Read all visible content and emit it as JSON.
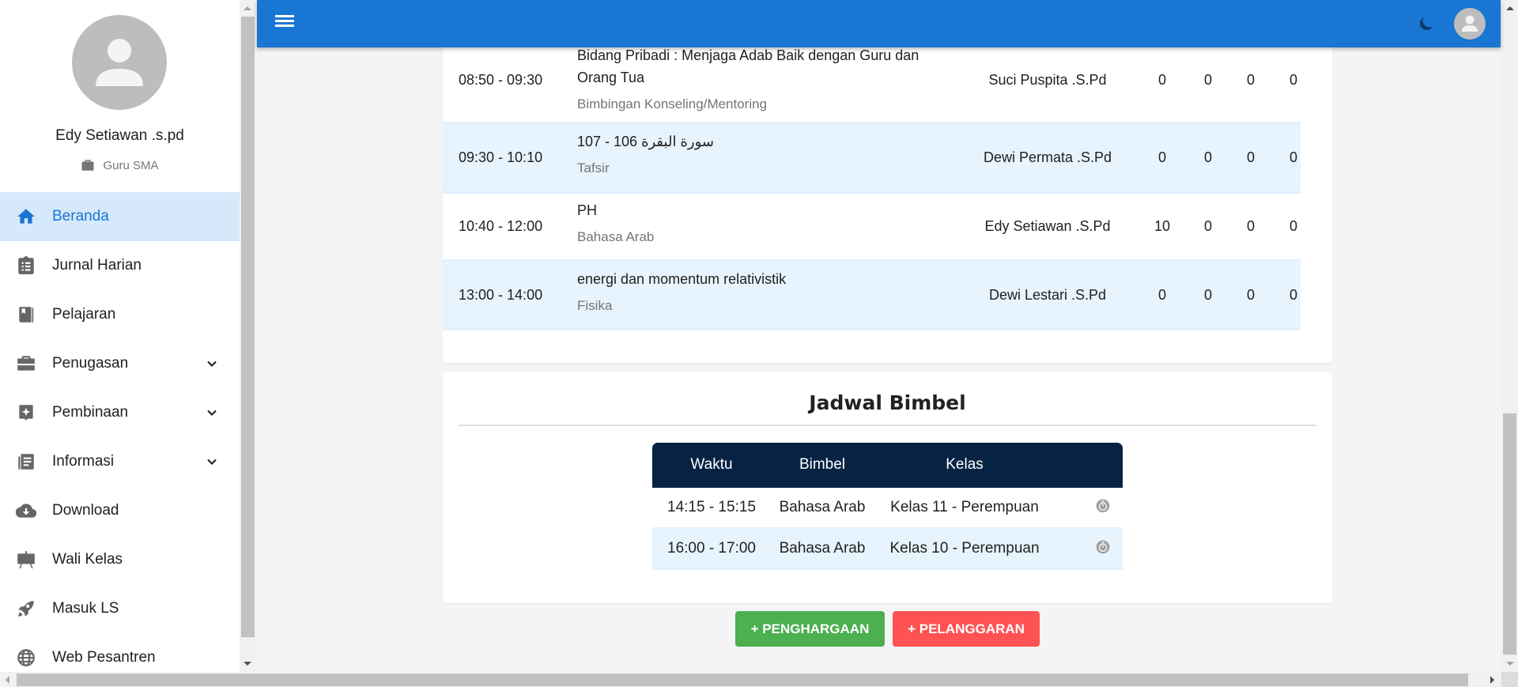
{
  "profile": {
    "name": "Edy Setiawan .s.pd",
    "role": "Guru SMA",
    "role_icon": "briefcase-icon"
  },
  "sidebar": {
    "items": [
      {
        "label": "Beranda",
        "icon": "home-icon",
        "active": true,
        "expandable": false
      },
      {
        "label": "Jurnal Harian",
        "icon": "clipboard-list-icon",
        "active": false,
        "expandable": false
      },
      {
        "label": "Pelajaran",
        "icon": "book-icon",
        "active": false,
        "expandable": false
      },
      {
        "label": "Penugasan",
        "icon": "briefcase-icon",
        "active": false,
        "expandable": true
      },
      {
        "label": "Pembinaan",
        "icon": "sparkle-badge-icon",
        "active": false,
        "expandable": true
      },
      {
        "label": "Informasi",
        "icon": "newspaper-icon",
        "active": false,
        "expandable": true
      },
      {
        "label": "Download",
        "icon": "cloud-download-icon",
        "active": false,
        "expandable": false
      },
      {
        "label": "Wali Kelas",
        "icon": "easel-icon",
        "active": false,
        "expandable": false
      },
      {
        "label": "Masuk LS",
        "icon": "rocket-icon",
        "active": false,
        "expandable": false
      },
      {
        "label": "Web Pesantren",
        "icon": "globe-icon",
        "active": false,
        "expandable": false
      }
    ]
  },
  "header": {
    "menu_icon": "hamburger-icon",
    "theme_icon": "moon-icon",
    "user_icon": "user-avatar-icon"
  },
  "colors": {
    "primary": "#1976d2",
    "active_bg": "#d6e9fb",
    "row_alt": "#e7f3fd",
    "table_head": "#062344",
    "success": "#4caf50",
    "danger": "#ff5252"
  },
  "lessons": [
    {
      "time": "08:50 - 09:30",
      "topic": "Bidang Pribadi : Menjaga Adab Baik dengan Guru dan Orang Tua",
      "subject": "Bimbingan Konseling/Mentoring",
      "teacher": "Suci Puspita .S.Pd",
      "counts": [
        "0",
        "0",
        "0",
        "0"
      ]
    },
    {
      "time": "09:30 - 10:10",
      "topic": "سورة البقرة 106 - 107",
      "subject": "Tafsir",
      "teacher": "Dewi Permata .S.Pd",
      "counts": [
        "0",
        "0",
        "0",
        "0"
      ]
    },
    {
      "time": "10:40 - 12:00",
      "topic": "PH",
      "subject": "Bahasa Arab",
      "teacher": "Edy Setiawan .S.Pd",
      "counts": [
        "10",
        "0",
        "0",
        "0"
      ]
    },
    {
      "time": "13:00 - 14:00",
      "topic": "energi dan momentum relativistik",
      "subject": "Fisika",
      "teacher": "Dewi Lestari .S.Pd",
      "counts": [
        "0",
        "0",
        "0",
        "0"
      ]
    }
  ],
  "bimbel": {
    "title": "Jadwal Bimbel",
    "headers": [
      "Waktu",
      "Bimbel",
      "Kelas"
    ],
    "rows": [
      {
        "time": "14:15 - 15:15",
        "subject": "Bahasa Arab",
        "class": "Kelas 11 - Perempuan",
        "action_icon": "timer-icon"
      },
      {
        "time": "16:00 - 17:00",
        "subject": "Bahasa Arab",
        "class": "Kelas 10 - Perempuan",
        "action_icon": "timer-icon"
      }
    ]
  },
  "actions": {
    "award_label": "+ PENGHARGAAN",
    "violation_label": "+ PELANGGARAN"
  }
}
